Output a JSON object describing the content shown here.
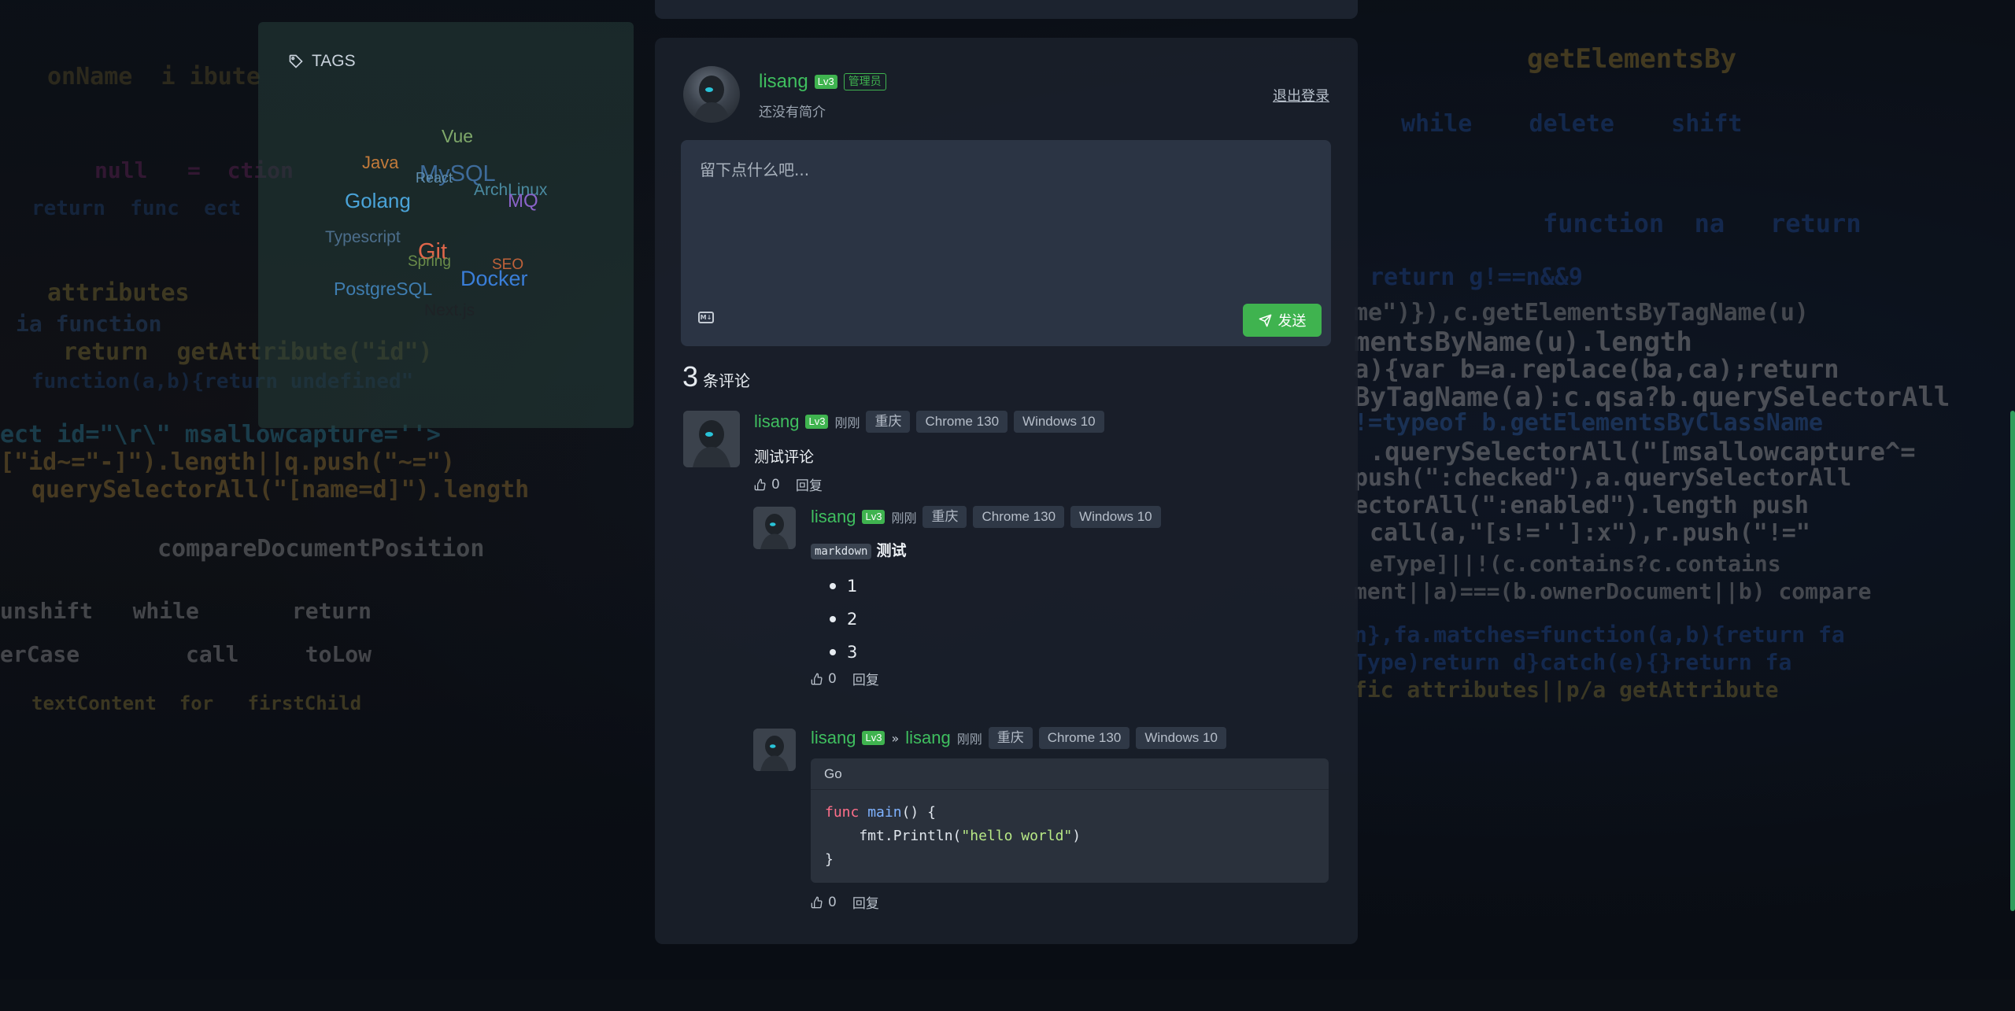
{
  "colors": {
    "accent_green": "#3fb34f",
    "username_green": "#3fbf5f",
    "card_bg": "#1a202a",
    "editor_bg": "#2b3444"
  },
  "tags_panel": {
    "title": "TAGS",
    "icon": "tag-icon",
    "tags": [
      {
        "label": "Vue",
        "color": "#7fa86a"
      },
      {
        "label": "Java",
        "color": "#c27a3a"
      },
      {
        "label": "MySQL",
        "color": "#3e6b9a"
      },
      {
        "label": "React",
        "color": "#5f8fb0"
      },
      {
        "label": "ArchLinux",
        "color": "#4a8aa0"
      },
      {
        "label": "Golang",
        "color": "#4aa3d8"
      },
      {
        "label": "MQ",
        "color": "#8a63c9"
      },
      {
        "label": "Typescript",
        "color": "#4c6e8c"
      },
      {
        "label": "Git",
        "color": "#e0664a"
      },
      {
        "label": "Spring",
        "color": "#6a8c4a"
      },
      {
        "label": "SEO",
        "color": "#c0623a"
      },
      {
        "label": "PostgreSQL",
        "color": "#3f7db0"
      },
      {
        "label": "Docker",
        "color": "#3a7ed8"
      },
      {
        "label": "Next.js",
        "color": "#1e2226"
      }
    ]
  },
  "profile": {
    "username": "lisang",
    "level": "Lv3",
    "role": "管理员",
    "bio": "还没有简介",
    "logout": "退出登录"
  },
  "editor": {
    "placeholder": "留下点什么吧...",
    "markdown_icon": "markdown-icon",
    "send_label": "发送"
  },
  "comments_count": {
    "number": "3",
    "label": "条评论"
  },
  "comments": [
    {
      "user": "lisang",
      "level": "Lv3",
      "time": "刚刚",
      "location": "重庆",
      "browser": "Chrome 130",
      "os": "Windows 10",
      "content": "测试评论",
      "likes": "0",
      "reply": "回复"
    },
    {
      "user": "lisang",
      "level": "Lv3",
      "time": "刚刚",
      "location": "重庆",
      "browser": "Chrome 130",
      "os": "Windows 10",
      "tag": "markdown",
      "title": "测试",
      "list": [
        "1",
        "2",
        "3"
      ],
      "likes": "0",
      "reply": "回复"
    },
    {
      "user": "lisang",
      "level": "Lv3",
      "reply_to": "lisang",
      "time": "刚刚",
      "location": "重庆",
      "browser": "Chrome 130",
      "os": "Windows 10",
      "code_lang": "Go",
      "code": {
        "line1_kw": "func",
        "line1_fn": "main",
        "line1_rest": "() {",
        "line2_pre": "    fmt.Println(",
        "line2_str": "\"hello world\"",
        "line2_post": ")",
        "line3": "}"
      },
      "likes": "0",
      "reply": "回复"
    }
  ]
}
